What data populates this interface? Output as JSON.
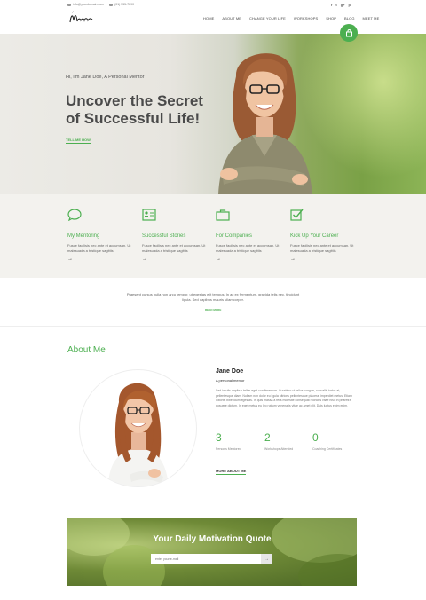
{
  "topbar": {
    "email": "info@yourdomain.com",
    "phone": "(01) 555-7890",
    "social": [
      "f",
      "t",
      "g+",
      "p"
    ]
  },
  "logo_text": "Mentor",
  "nav": [
    "HOME",
    "ABOUT ME",
    "CHANGE YOUR LIFE",
    "WORKSHOPS",
    "SHOP",
    "BLOG",
    "MEET ME"
  ],
  "hero": {
    "subtitle": "Hi, I'm Jane Doe, A Personal Mentor",
    "title": "Uncover the Secret of Successful Life!",
    "link": "TELL ME HOW"
  },
  "features": [
    {
      "icon": "chat-bubble-icon",
      "title": "My Mentoring",
      "desc": "Fusce facilisis nec ante et accumsan. Ut malesuada a tristique sagittis"
    },
    {
      "icon": "id-card-icon",
      "title": "Successful Stories",
      "desc": "Fusce facilisis nec ante et accumsan. Ut malesuada a tristique sagittis"
    },
    {
      "icon": "briefcase-icon",
      "title": "For Companies",
      "desc": "Fusce facilisis nec ante et accumsan. Ut malesuada a tristique sagittis"
    },
    {
      "icon": "checkbox-icon",
      "title": "Kick Up Your Career",
      "desc": "Fusce facilisis nec ante et accumsan. Ut malesuada a tristique sagittis"
    }
  ],
  "feature_arrow": "→",
  "strip": {
    "text": "Praesent cursus nulla non arcu tempor, ut egestas elit tempus. In ac ex fermentum, gravida felis nec, tincidunt ligula. Sed dapibus mauris ullamcorper.",
    "link": "READ MORE"
  },
  "about": {
    "heading": "About Me",
    "name": "Jane Doe",
    "role": "A personal mentor",
    "bio": "Sed iaculis dapibus tellus eget condimentum. Curabitur ut tellus congue, convallis tortor at, pellentesque diam. Nullam non dolor eu ligula ultrices pellentesque placerat imperdiet metus. Etiam lobortis bibendum egestas. In quis massa a felis molestie consequat rhoncus vitae nisl. In pharetra posuere dictum. In eget metus eu leo rutrum venenatis vitae ac amet elit. Duis luctus enim enim.",
    "stats": [
      {
        "num": "3",
        "label": "Persons Mentored"
      },
      {
        "num": "2",
        "label": "Workshops Attended"
      },
      {
        "num": "0",
        "label": "Coaching Certificates"
      }
    ],
    "link": "MORE ABOUT ME"
  },
  "newsletter": {
    "title": "Your Daily Motivation Quote",
    "placeholder": "enter your e-mail",
    "button": "→"
  },
  "colors": {
    "accent": "#4caf50"
  }
}
